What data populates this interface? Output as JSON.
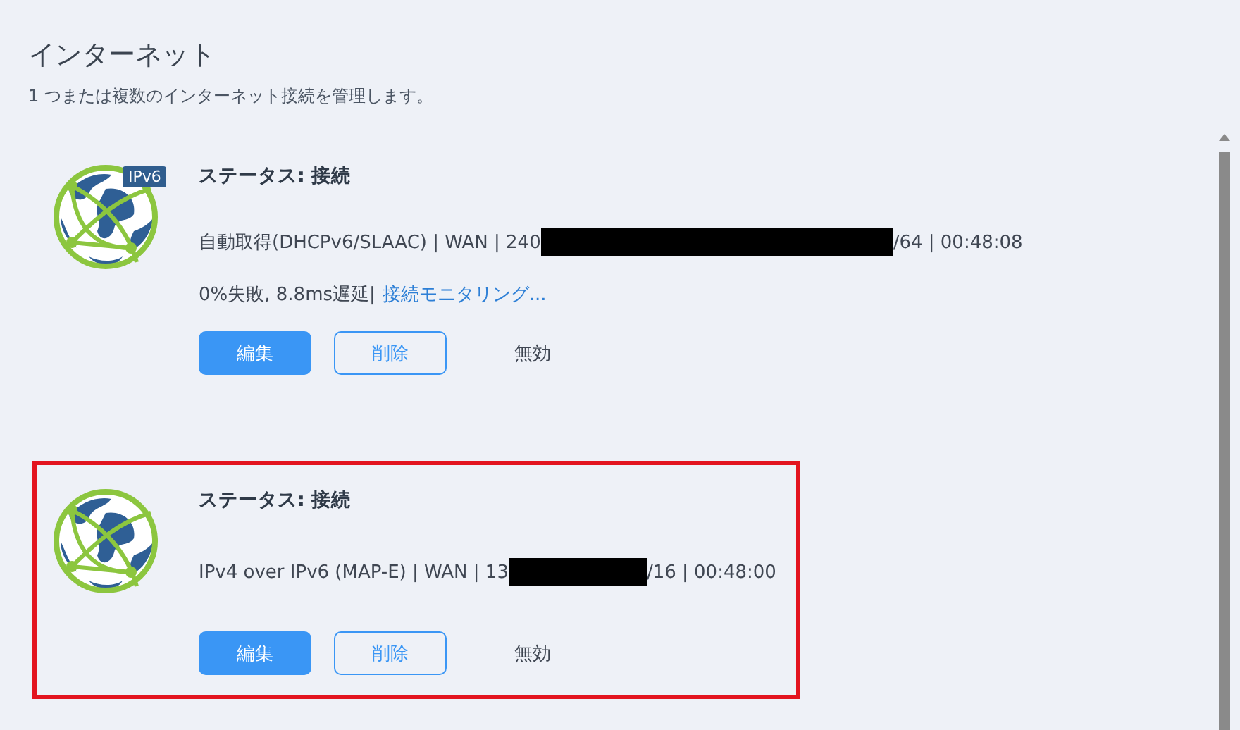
{
  "page": {
    "title": "インターネット",
    "subtitle": "1 つまたは複数のインターネット接続を管理します。"
  },
  "connections": [
    {
      "badge": "IPv6",
      "status": "ステータス: 接続",
      "details_before": "自動取得(DHCPv6/SLAAC) | WAN | 240",
      "redacted": true,
      "details_after": "/64 | 00:48:08",
      "stats": "0%失敗, 8.8ms遅延|",
      "monitor_link": "接続モニタリング...",
      "highlighted": false,
      "buttons": {
        "edit": "編集",
        "delete": "削除",
        "disable": "無効"
      }
    },
    {
      "status": "ステータス: 接続",
      "details_before": "IPv4 over IPv6 (MAP-E) | WAN | 13",
      "redacted": true,
      "details_after": "/16 | 00:48:00",
      "highlighted": true,
      "buttons": {
        "edit": "編集",
        "delete": "削除",
        "disable": "無効"
      }
    }
  ]
}
